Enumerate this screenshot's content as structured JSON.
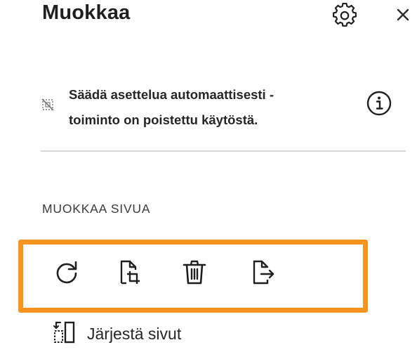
{
  "panel": {
    "title": "Muokkaa",
    "settings_icon": "gear-icon",
    "close_icon": "close-icon"
  },
  "notice": {
    "icon": "auto-layout-disabled-icon",
    "line1": "Säädä asettelua automaattisesti -",
    "line2": "toiminto on poistettu käytöstä.",
    "info_icon": "info-icon"
  },
  "edit_page": {
    "heading": "MUOKKAA SIVUA",
    "tools": [
      {
        "icon": "rotate-icon"
      },
      {
        "icon": "crop-page-icon"
      },
      {
        "icon": "delete-icon"
      },
      {
        "icon": "extract-page-icon"
      }
    ],
    "organize_label": "Järjestä sivut",
    "organize_icon": "organize-pages-icon"
  },
  "colors": {
    "highlight": "#f7941d",
    "text": "#1f1f1f",
    "divider": "#d6d6d6"
  }
}
